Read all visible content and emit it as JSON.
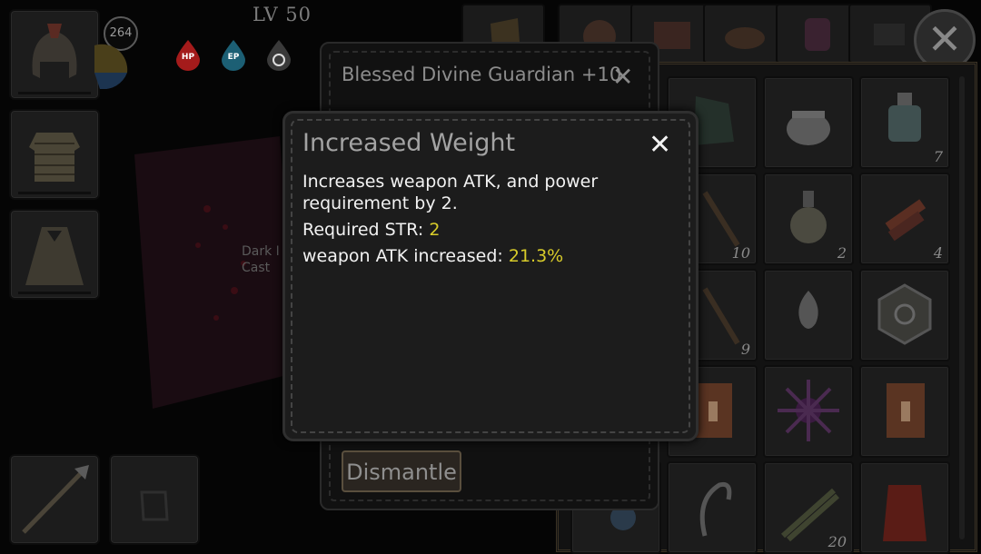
{
  "player": {
    "level": "LV 50",
    "badge": "264",
    "status_icons": [
      {
        "label": "HP",
        "color": "#b01c1c"
      },
      {
        "label": "EP",
        "color": "#1f6e86"
      },
      {
        "label": "",
        "color": "#3a3a3a"
      }
    ]
  },
  "area_label": "Dark I\nCast",
  "item_panel": {
    "title": "Blessed Divine Guardian +10",
    "close_icon": "close-icon",
    "dismantle_label": "Dismantle"
  },
  "modal": {
    "title": "Increased Weight",
    "description": "Increases weapon ATK, and power requirement by 2.",
    "required_label": "Required STR:",
    "required_value": "2",
    "atk_label": "weapon ATK increased:",
    "atk_value": "21.3%",
    "accent_color": "#d8cc2a"
  },
  "inventory": {
    "rows": [
      [
        {
          "icon": "cloth-icon",
          "count": ""
        },
        {
          "icon": "pot-icon",
          "count": ""
        },
        {
          "icon": "potion-bottle-icon",
          "count": "7"
        }
      ],
      [
        {
          "icon": "stick-icon",
          "count": "10"
        },
        {
          "icon": "flask-icon",
          "count": "2"
        },
        {
          "icon": "wood-plank-icon",
          "count": "4"
        }
      ],
      [
        {
          "icon": "staff-icon",
          "count": "9"
        },
        {
          "icon": "flame-emblem-icon",
          "count": ""
        },
        {
          "icon": "hex-rune-icon",
          "count": ""
        }
      ],
      [
        {
          "icon": "scroll-candle-icon",
          "count": ""
        },
        {
          "icon": "dark-star-icon",
          "count": ""
        },
        {
          "icon": "scroll-candle-icon",
          "count": ""
        }
      ],
      [
        {
          "icon": "orb-icon",
          "count": ""
        },
        {
          "icon": "hook-rope-icon",
          "count": ""
        },
        {
          "icon": "herb-bundle-icon",
          "count": "20"
        },
        {
          "icon": "red-robe-icon",
          "count": ""
        }
      ]
    ]
  }
}
